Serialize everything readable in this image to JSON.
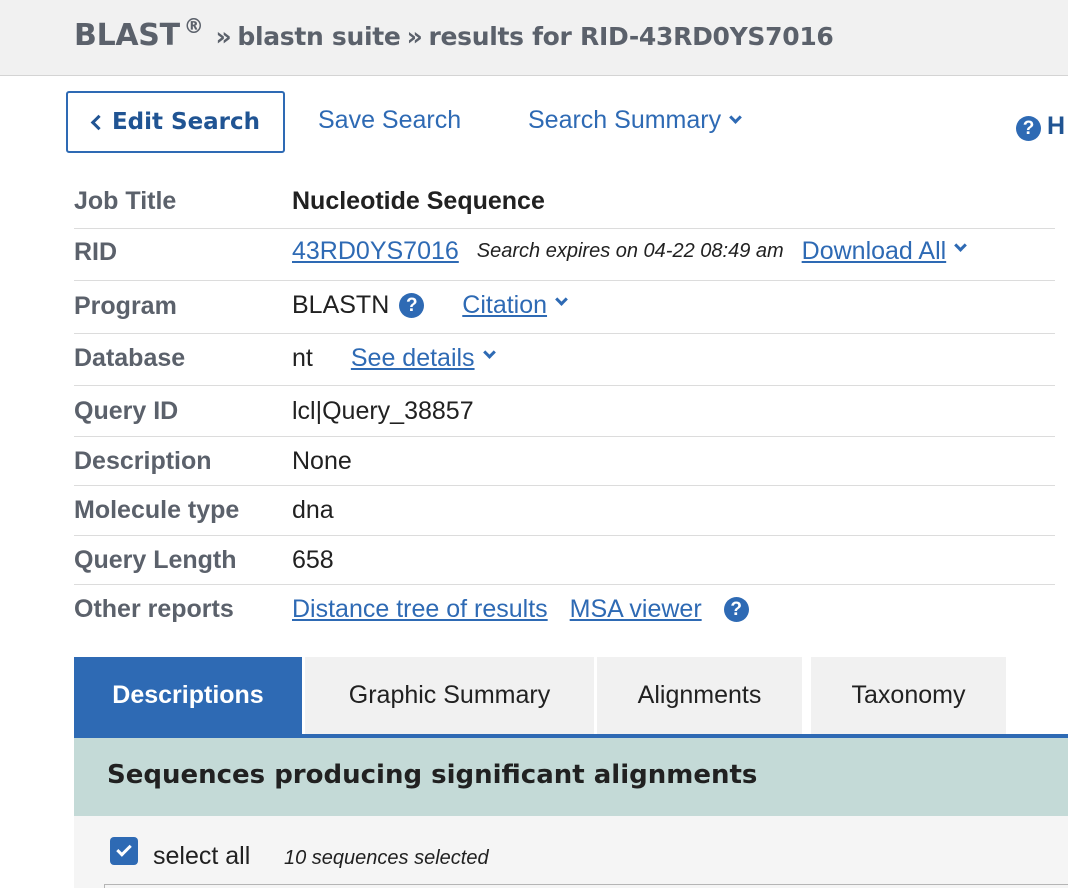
{
  "breadcrumb": {
    "brand": "BLAST",
    "reg": "®",
    "sep1": "»",
    "suite": "blastn suite",
    "sep2": "»",
    "results": "results for RID-43RD0YS7016"
  },
  "toolbar": {
    "edit_search": "Edit Search",
    "save_search": "Save Search",
    "search_summary": "Search Summary",
    "help_icon_text": "?",
    "help_partial": "H"
  },
  "job": {
    "rows": [
      {
        "label": "Job Title",
        "value": "Nucleotide Sequence"
      },
      {
        "label": "RID",
        "rid": "43RD0YS7016",
        "expires": "Search expires on 04-22 08:49 am",
        "download": "Download All"
      },
      {
        "label": "Program",
        "value": "BLASTN",
        "help": "?",
        "citation": "Citation"
      },
      {
        "label": "Database",
        "value": "nt",
        "details": "See details"
      },
      {
        "label": "Query ID",
        "value": "lcl|Query_38857"
      },
      {
        "label": "Description",
        "value": "None"
      },
      {
        "label": "Molecule type",
        "value": "dna"
      },
      {
        "label": "Query Length",
        "value": "658"
      },
      {
        "label": "Other reports",
        "distance_tree": "Distance tree of results",
        "msa": "MSA viewer",
        "help": "?"
      }
    ]
  },
  "tabs": [
    {
      "label": "Descriptions",
      "active": true
    },
    {
      "label": "Graphic Summary",
      "active": false
    },
    {
      "label": "Alignments",
      "active": false
    },
    {
      "label": "Taxonomy",
      "active": false
    }
  ],
  "results": {
    "section_title": "Sequences producing significant alignments",
    "select_all_label": "select all",
    "selected_count": "10 sequences selected",
    "select_all_checked": true
  },
  "colors": {
    "accent": "#2e6ab4",
    "section_bg": "#c4dad7",
    "breadcrumb_bg": "#f1f1f1"
  }
}
